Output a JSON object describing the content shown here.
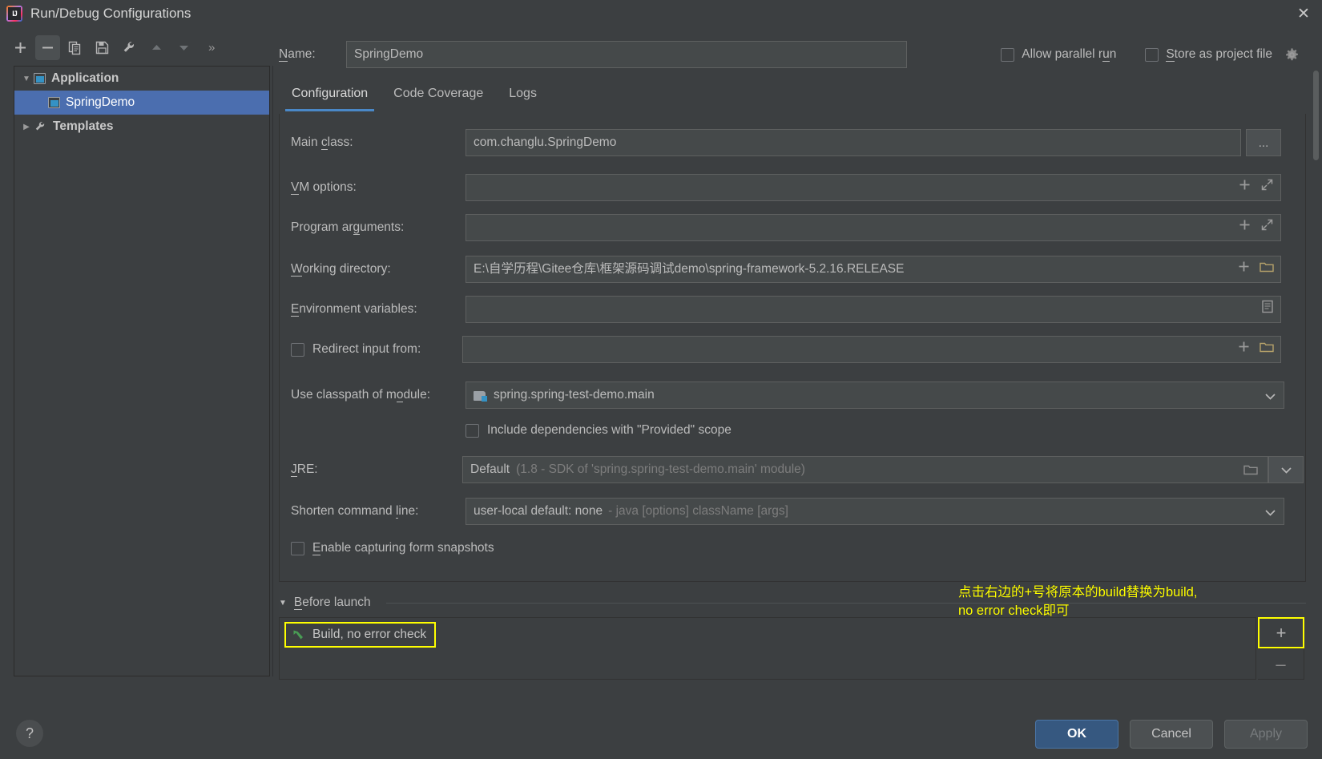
{
  "window": {
    "title": "Run/Debug Configurations",
    "logo_text": "IJ",
    "close_icon": "✕"
  },
  "left_toolbar": {
    "buttons": [
      {
        "name": "add",
        "glyph": "+"
      },
      {
        "name": "remove",
        "glyph": "–"
      },
      {
        "name": "copy",
        "glyph": "❐"
      },
      {
        "name": "save",
        "glyph": "🖫"
      },
      {
        "name": "edit-templates",
        "glyph": "🔧"
      },
      {
        "name": "move-up",
        "glyph": "▲"
      },
      {
        "name": "move-down",
        "glyph": "▼"
      }
    ],
    "more_glyph": "»"
  },
  "tree": {
    "items": [
      {
        "label": "Application",
        "twisty": "▼",
        "icon": "application-icon",
        "indent": 0,
        "selected": false,
        "bold": true
      },
      {
        "label": "SpringDemo",
        "twisty": "",
        "icon": "application-icon",
        "indent": 1,
        "selected": true,
        "bold": false
      },
      {
        "label": "Templates",
        "twisty": "▶",
        "icon": "wrench-icon",
        "indent": 0,
        "selected": false,
        "bold": true
      }
    ]
  },
  "header": {
    "name_label": "Name:",
    "name_value": "SpringDemo",
    "allow_parallel_run": "Allow parallel run",
    "store_as_project_file": "Store as project file",
    "allow_parallel_run_checked": false,
    "store_as_project_file_checked": false
  },
  "tabs": [
    {
      "label": "Configuration",
      "active": true
    },
    {
      "label": "Code Coverage",
      "active": false
    },
    {
      "label": "Logs",
      "active": false
    }
  ],
  "form": {
    "main_class": {
      "label": "Main class:",
      "value": "com.changlu.SpringDemo",
      "browse": "..."
    },
    "vm_options": {
      "label": "VM options:",
      "value": "",
      "icons": [
        "+",
        "⤢"
      ]
    },
    "program_arguments": {
      "label": "Program arguments:",
      "value": "",
      "icons": [
        "+",
        "⤢"
      ]
    },
    "working_directory": {
      "label": "Working directory:",
      "value": "E:\\自学历程\\Gitee仓库\\框架源码调试demo\\spring-framework-5.2.16.RELEASE",
      "icons": [
        "+",
        "📁"
      ]
    },
    "environment_variables": {
      "label": "Environment variables:",
      "value": "",
      "icons": [
        "▤"
      ]
    },
    "redirect_input": {
      "label": "Redirect input from:",
      "value": "",
      "checked": false,
      "icons": [
        "+",
        "📁"
      ]
    },
    "classpath_module": {
      "label": "Use classpath of module:",
      "value": "spring.spring-test-demo.main",
      "arrow": "▼"
    },
    "include_provided": {
      "label": "Include dependencies with \"Provided\" scope",
      "checked": false
    },
    "jre": {
      "label": "JRE:",
      "value": "Default",
      "value_dim": "(1.8 - SDK of 'spring.spring-test-demo.main' module)",
      "icons": [
        "📁"
      ],
      "arrow": "▼"
    },
    "shorten_command_line": {
      "label": "Shorten command line:",
      "value": "user-local default: none",
      "value_dim": "- java [options] className [args]",
      "arrow": "▼"
    },
    "enable_capturing": {
      "label": "Enable capturing form snapshots",
      "checked": false
    }
  },
  "before_launch": {
    "header": "Before launch",
    "twisty": "▼",
    "items": [
      {
        "label": "Build, no error check",
        "icon": "build-hammer-icon",
        "highlighted": true
      }
    ],
    "add_button": "+",
    "remove_button": "–"
  },
  "annotation": {
    "text": "点击右边的+号将原本的build替换为build,\nno error check即可",
    "color": "#ffff00"
  },
  "footer": {
    "help": "?",
    "ok": "OK",
    "cancel": "Cancel",
    "apply": "Apply",
    "apply_disabled": true
  },
  "colors": {
    "background": "#3c3f41",
    "field_background": "#45494a",
    "selection": "#4b6eaf",
    "accent": "#4a88c7",
    "primary_button": "#365880",
    "annotation": "#ffff00",
    "text": "#bbbbbb",
    "dim_text": "#7d7d7d"
  }
}
